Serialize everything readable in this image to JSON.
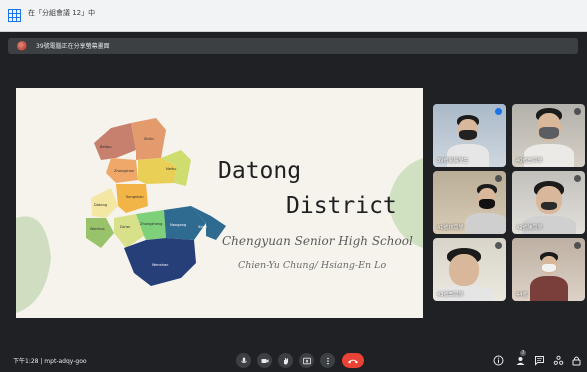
{
  "tab": {
    "title": "在「分組會議 12」中"
  },
  "banner": {
    "text": "39號電腦正在分享螢幕畫面"
  },
  "slide": {
    "title_line1": "Datong",
    "title_line2": "District",
    "school": "Chengyuan Senior High School",
    "authors": "Chien-Yu Chung/ Hsiang-En Lo",
    "districts": [
      "Beitou",
      "Shilin",
      "Zhongshan",
      "Neihu",
      "Datong",
      "Songshan",
      "Wanhua",
      "Da'an",
      "Nangang",
      "Zhongzheng",
      "Xinyi",
      "Wenshan"
    ]
  },
  "participants": [
    {
      "name": "39號電腦學生",
      "speaking": true
    },
    {
      "name": "40號王同學",
      "speaking": false
    },
    {
      "name": "41號林同學",
      "speaking": false
    },
    {
      "name": "42號陳同學",
      "speaking": false
    },
    {
      "name": "43號李同學",
      "speaking": false
    },
    {
      "name": "44號",
      "speaking": false
    }
  ],
  "bottom": {
    "meeting_info": "下午1:28  |  mpt-adqy-goo",
    "people_count": "7"
  },
  "icons": [
    "grid-icon",
    "screen-share-avatar-icon",
    "mic-icon",
    "camera-icon",
    "raise-hand-icon",
    "present-icon",
    "more-options-icon",
    "end-call-icon",
    "info-icon",
    "people-icon",
    "chat-icon",
    "activities-icon",
    "lock-icon"
  ]
}
